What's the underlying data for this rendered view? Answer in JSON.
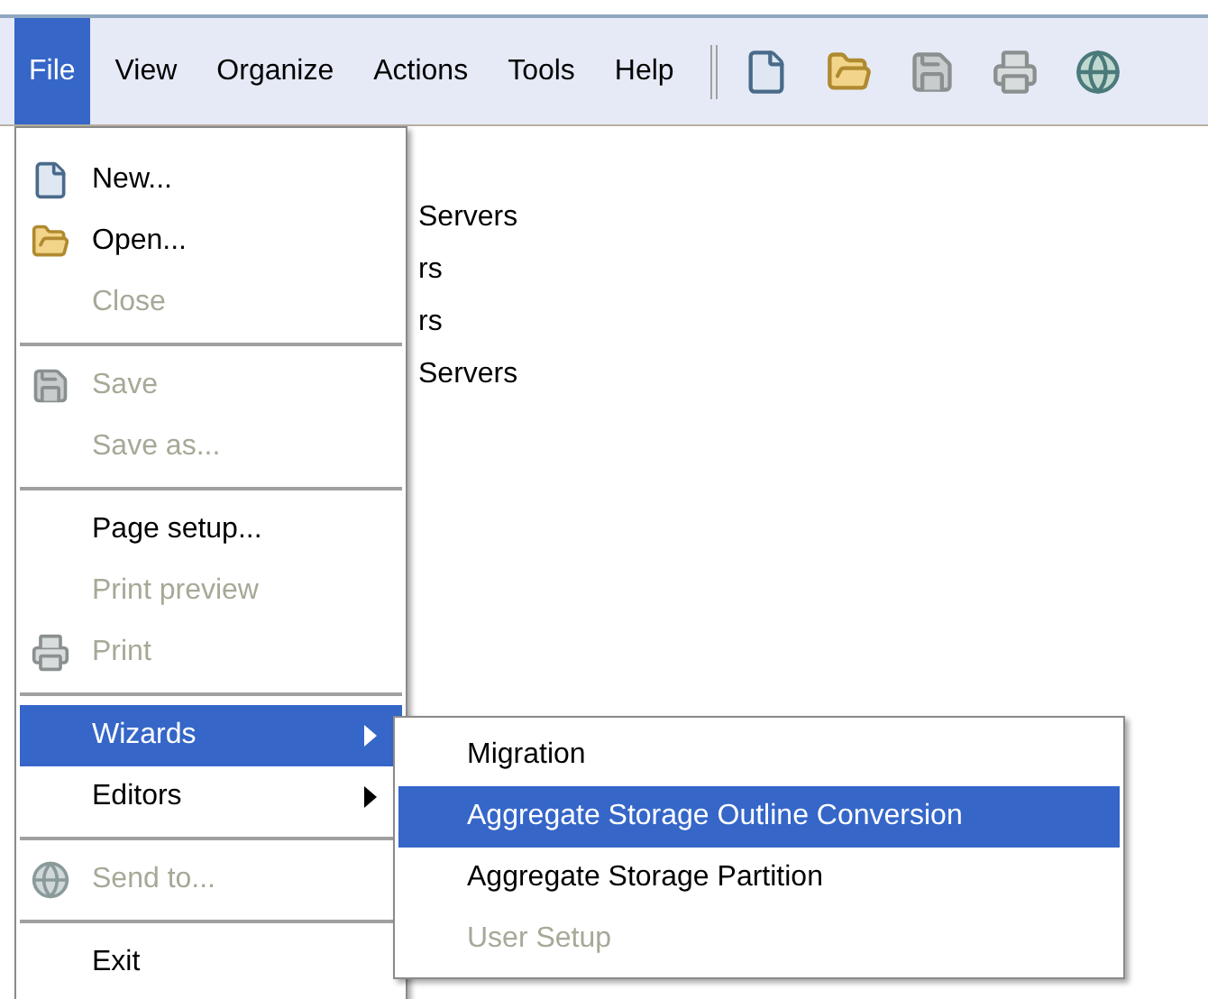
{
  "menubar": [
    {
      "label": "File",
      "selected": true
    },
    {
      "label": "View",
      "selected": false
    },
    {
      "label": "Organize",
      "selected": false
    },
    {
      "label": "Actions",
      "selected": false
    },
    {
      "label": "Tools",
      "selected": false
    },
    {
      "label": "Help",
      "selected": false
    }
  ],
  "background_tree": [
    "Servers",
    "rs",
    "rs",
    "Servers"
  ],
  "file_menu": [
    {
      "kind": "item",
      "label": "New...",
      "disabled": false,
      "selected": false
    },
    {
      "kind": "item",
      "label": "Open...",
      "disabled": false,
      "selected": false
    },
    {
      "kind": "item",
      "label": "Close",
      "disabled": true,
      "selected": false
    },
    {
      "kind": "separator"
    },
    {
      "kind": "item",
      "label": "Save",
      "disabled": true,
      "selected": false
    },
    {
      "kind": "item",
      "label": "Save as...",
      "disabled": true,
      "selected": false
    },
    {
      "kind": "separator"
    },
    {
      "kind": "item",
      "label": "Page setup...",
      "disabled": false,
      "selected": false
    },
    {
      "kind": "item",
      "label": "Print preview",
      "disabled": true,
      "selected": false
    },
    {
      "kind": "item",
      "label": "Print",
      "disabled": true,
      "selected": false
    },
    {
      "kind": "separator"
    },
    {
      "kind": "submenu",
      "label": "Wizards",
      "disabled": false,
      "selected": true,
      "children": [
        {
          "label": "Migration",
          "disabled": false,
          "selected": false
        },
        {
          "label": "Aggregate Storage Outline Conversion",
          "disabled": false,
          "selected": true
        },
        {
          "label": "Aggregate Storage Partition",
          "disabled": false,
          "selected": false
        },
        {
          "label": "User Setup",
          "disabled": true,
          "selected": false
        }
      ]
    },
    {
      "kind": "submenu",
      "label": "Editors",
      "disabled": false,
      "selected": false
    },
    {
      "kind": "separator"
    },
    {
      "kind": "item",
      "label": "Send to...",
      "disabled": true,
      "selected": false
    },
    {
      "kind": "separator"
    },
    {
      "kind": "item",
      "label": "Exit",
      "disabled": false,
      "selected": false
    }
  ]
}
